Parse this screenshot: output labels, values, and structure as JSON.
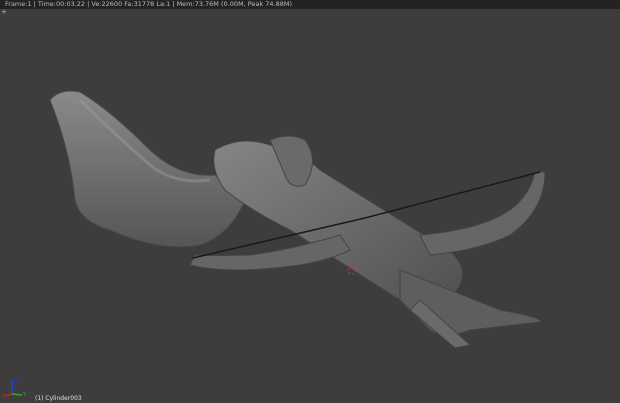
{
  "info_bar": {
    "text": "Frame:1 | Time:00:03.22 | Ve:22600 Fa:31778 La:1 | Mem:73.76M (0.00M, Peak 74.88M)"
  },
  "viewport": {
    "object_label": "(1) Cylinder003",
    "axes": {
      "x": "X",
      "y": "Y",
      "z": "Z"
    },
    "colors": {
      "background": "#3d3d3d",
      "mesh": "#6e6e6e",
      "x_axis": "#d02020",
      "y_axis": "#30b030",
      "z_axis": "#2040e0"
    }
  }
}
